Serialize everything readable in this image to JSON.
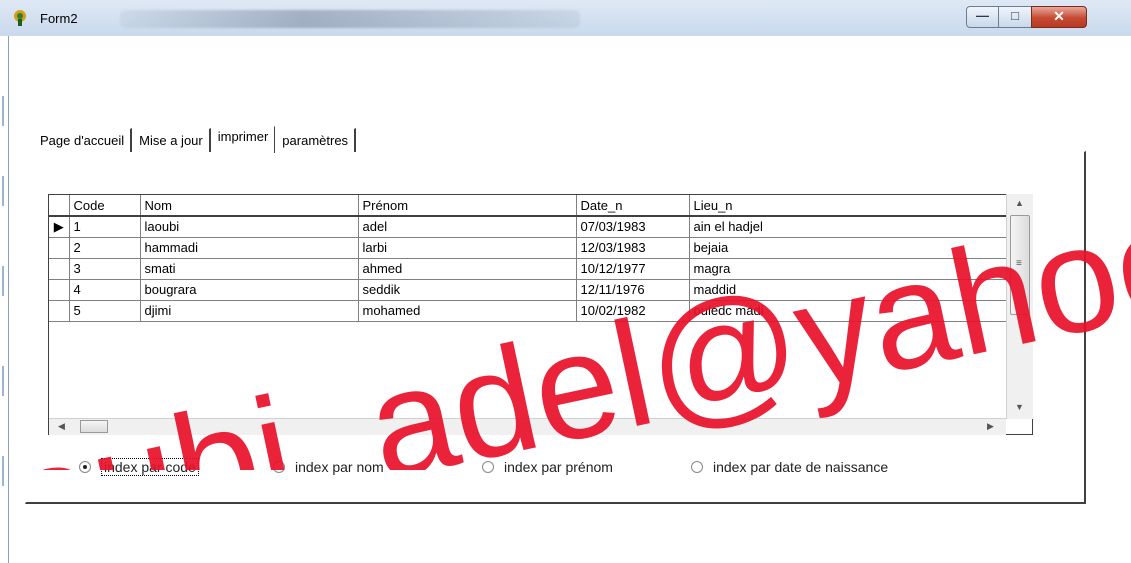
{
  "window": {
    "title": "Form2",
    "minimize_label": "—",
    "maximize_label": "□",
    "close_label": "✕"
  },
  "tabs": [
    {
      "label": "Page d'accueil",
      "active": false
    },
    {
      "label": "Mise a jour",
      "active": false
    },
    {
      "label": "imprimer",
      "active": true
    },
    {
      "label": "paramètres",
      "active": false
    }
  ],
  "grid": {
    "columns": [
      "Code",
      "Nom",
      "Prénom",
      "Date_n",
      "Lieu_n"
    ],
    "rows": [
      {
        "code": "1",
        "nom": "laoubi",
        "prenom": "adel",
        "date_n": "07/03/1983",
        "lieu_n": "ain el hadjel",
        "current": true
      },
      {
        "code": "2",
        "nom": "hammadi",
        "prenom": "larbi",
        "date_n": "12/03/1983",
        "lieu_n": "bejaia",
        "current": false
      },
      {
        "code": "3",
        "nom": "smati",
        "prenom": "ahmed",
        "date_n": "10/12/1977",
        "lieu_n": "magra",
        "current": false
      },
      {
        "code": "4",
        "nom": "bougrara",
        "prenom": "seddik",
        "date_n": "12/11/1976",
        "lieu_n": "maddid",
        "current": false
      },
      {
        "code": "5",
        "nom": "djimi",
        "prenom": "mohamed",
        "date_n": "10/02/1982",
        "lieu_n": "ouledc madi",
        "current": false
      }
    ],
    "current_row_marker": "▶"
  },
  "radios": [
    {
      "label": "index par code",
      "checked": true
    },
    {
      "label": "index par nom",
      "checked": false
    },
    {
      "label": "index par prénom",
      "checked": false
    },
    {
      "label": "index par date de naissance",
      "checked": false
    }
  ],
  "watermark": {
    "text": "oubi_adel@yahoo",
    "color": "#e8102a"
  },
  "colors": {
    "titlebar": "#c9d9ec",
    "close_button": "#c64a32"
  }
}
